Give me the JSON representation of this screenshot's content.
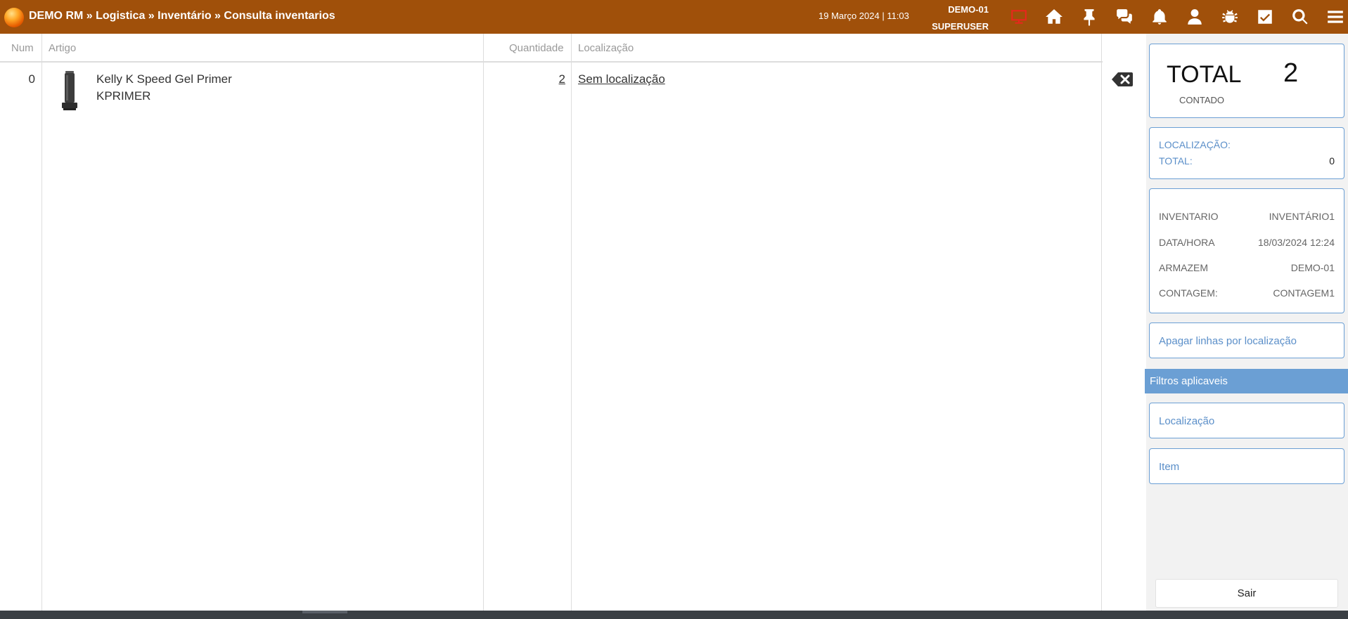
{
  "header": {
    "breadcrumb": "DEMO RM » Logistica » Inventário » Consulta inventarios",
    "datetime": "19 Março 2024 | 11:03",
    "company": "DEMO-01",
    "user": "SUPERUSER",
    "icons": [
      "monitor-icon",
      "home-icon",
      "pin-icon",
      "chat-icon",
      "bell-icon",
      "user-icon",
      "bug-icon",
      "checkbox-icon",
      "search-icon",
      "menu-icon"
    ],
    "accent_color": "#a0500a",
    "monitor_icon_color": "#e8271c"
  },
  "table": {
    "columns": [
      "Num",
      "Artigo",
      "Quantidade",
      "Localização"
    ],
    "rows": [
      {
        "num": "0",
        "name": "Kelly K Speed Gel Primer",
        "code": "KPRIMER",
        "qty": "2",
        "location": "Sem localização"
      }
    ]
  },
  "summary": {
    "total_label": "TOTAL",
    "total_value": "2",
    "total_sub": "CONTADO"
  },
  "location_box": {
    "label": "LOCALIZAÇÃO:",
    "total_label": "TOTAL:",
    "total_value": "0"
  },
  "info": [
    {
      "key": "INVENTARIO",
      "value": "INVENTÁRIO1"
    },
    {
      "key": "DATA/HORA",
      "value": "18/03/2024 12:24"
    },
    {
      "key": "ARMAZEM",
      "value": "DEMO-01"
    },
    {
      "key": "CONTAGEM:",
      "value": "CONTAGEM1"
    }
  ],
  "actions": {
    "delete_by_location": "Apagar linhas por localização",
    "filters_header": "Filtros aplicaveis",
    "filter_location": "Localização",
    "filter_item": "Item",
    "exit": "Sair"
  }
}
